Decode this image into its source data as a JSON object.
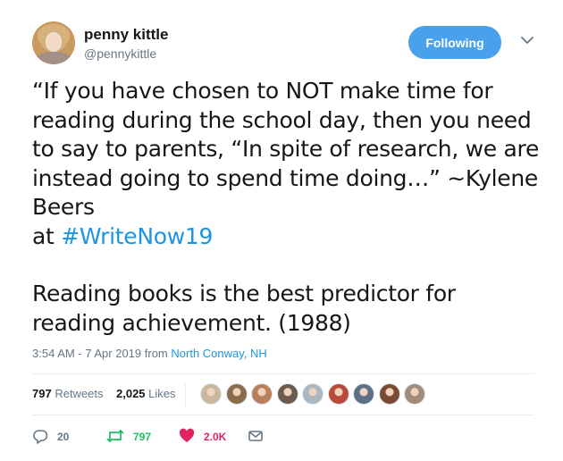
{
  "user": {
    "display_name": "penny kittle",
    "handle": "@pennykittle",
    "follow_label": "Following"
  },
  "tweet": {
    "para1_prefix": "“If you have chosen to NOT make time for reading during the school day, then you need to say to parents, “In spite of research, we are instead going to spend time doing…” ~Kylene Beers",
    "para1_at": "at",
    "hashtag": "#WriteNow19",
    "para2": "Reading books is the best predictor for reading achievement. (1988)"
  },
  "meta": {
    "timestamp": "3:54 AM - 7 Apr 2019",
    "from": "from",
    "location": "North Conway, NH"
  },
  "stats": {
    "retweets_count": "797",
    "retweets_label": "Retweets",
    "likes_count": "2,025",
    "likes_label": "Likes"
  },
  "likers": [
    {
      "icon": "liker-avatar",
      "color": "#cbb79d"
    },
    {
      "icon": "liker-avatar",
      "color": "#8a6b4c"
    },
    {
      "icon": "liker-avatar",
      "color": "#b9805e"
    },
    {
      "icon": "liker-avatar",
      "color": "#6b5a4d"
    },
    {
      "icon": "default-avatar",
      "color": "#aab8c2"
    },
    {
      "icon": "liker-avatar",
      "color": "#b94a3b"
    },
    {
      "icon": "liker-avatar",
      "color": "#5c6f86"
    },
    {
      "icon": "liker-avatar",
      "color": "#7a4b33"
    },
    {
      "icon": "liker-avatar",
      "color": "#9e8c7d"
    }
  ],
  "actions": {
    "replies": "20",
    "retweets": "797",
    "likes": "2.0K"
  },
  "colors": {
    "accent": "#1b95e0",
    "follow_button": "#4aa1eb",
    "retweet_green": "#17bf63",
    "like_red": "#e0245e",
    "muted": "#657786"
  }
}
